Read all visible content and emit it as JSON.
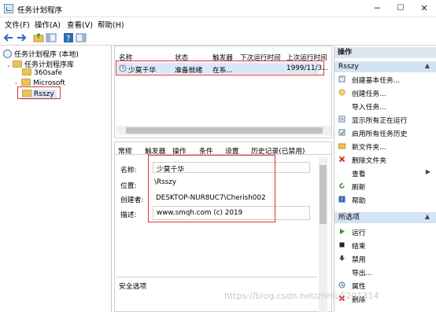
{
  "window": {
    "title": "任务计划程序",
    "minimize": "─",
    "maximize": "☐",
    "close": "✕"
  },
  "menu": [
    "文件(F)",
    "操作(A)",
    "查看(V)",
    "帮助(H)"
  ],
  "tree": {
    "root": "任务计划程序 (本地)",
    "library": "任务计划程序库",
    "folders": [
      "360safe",
      "Microsoft",
      "Rsszy"
    ]
  },
  "task_list": {
    "columns": [
      "名称",
      "状态",
      "触发器",
      "下次运行时间",
      "上次运行时间"
    ],
    "rows": [
      {
        "name": "少莫千华",
        "status": "准备就绪",
        "trigger": "在系...",
        "next_run": "",
        "last_run": "1999/11/3..."
      }
    ]
  },
  "detail": {
    "tabs": [
      "常规",
      "触发器",
      "操作",
      "条件",
      "设置",
      "历史记录(已禁用)"
    ],
    "name_label": "名称:",
    "name_value": "少莫千华",
    "location_label": "位置:",
    "location_value": "\\Rsszy",
    "author_label": "创建者:",
    "author_value": "DESKTOP-NUR8UC7\\Cherish002",
    "desc_label": "描述:",
    "desc_value": "www.smqh.com  (c) 2019",
    "security_label": "安全选项"
  },
  "actions": {
    "header": "操作",
    "section1": "Rsszy",
    "items1": [
      "创建基本任务...",
      "创建任务...",
      "导入任务...",
      "显示所有正在运行",
      "启用所有任务历史",
      "新文件夹...",
      "删除文件夹",
      "查看",
      "刷新",
      "帮助"
    ],
    "section2": "所选项",
    "items2": [
      "运行",
      "结束",
      "禁用",
      "导出...",
      "属性",
      "删除"
    ]
  },
  "watermark": "https://blog.csdn.net/zhnlu5201314",
  "colors": {
    "highlight_box": "#e03333",
    "selection": "#d9e8f8",
    "action_header": "#dde6ef"
  }
}
